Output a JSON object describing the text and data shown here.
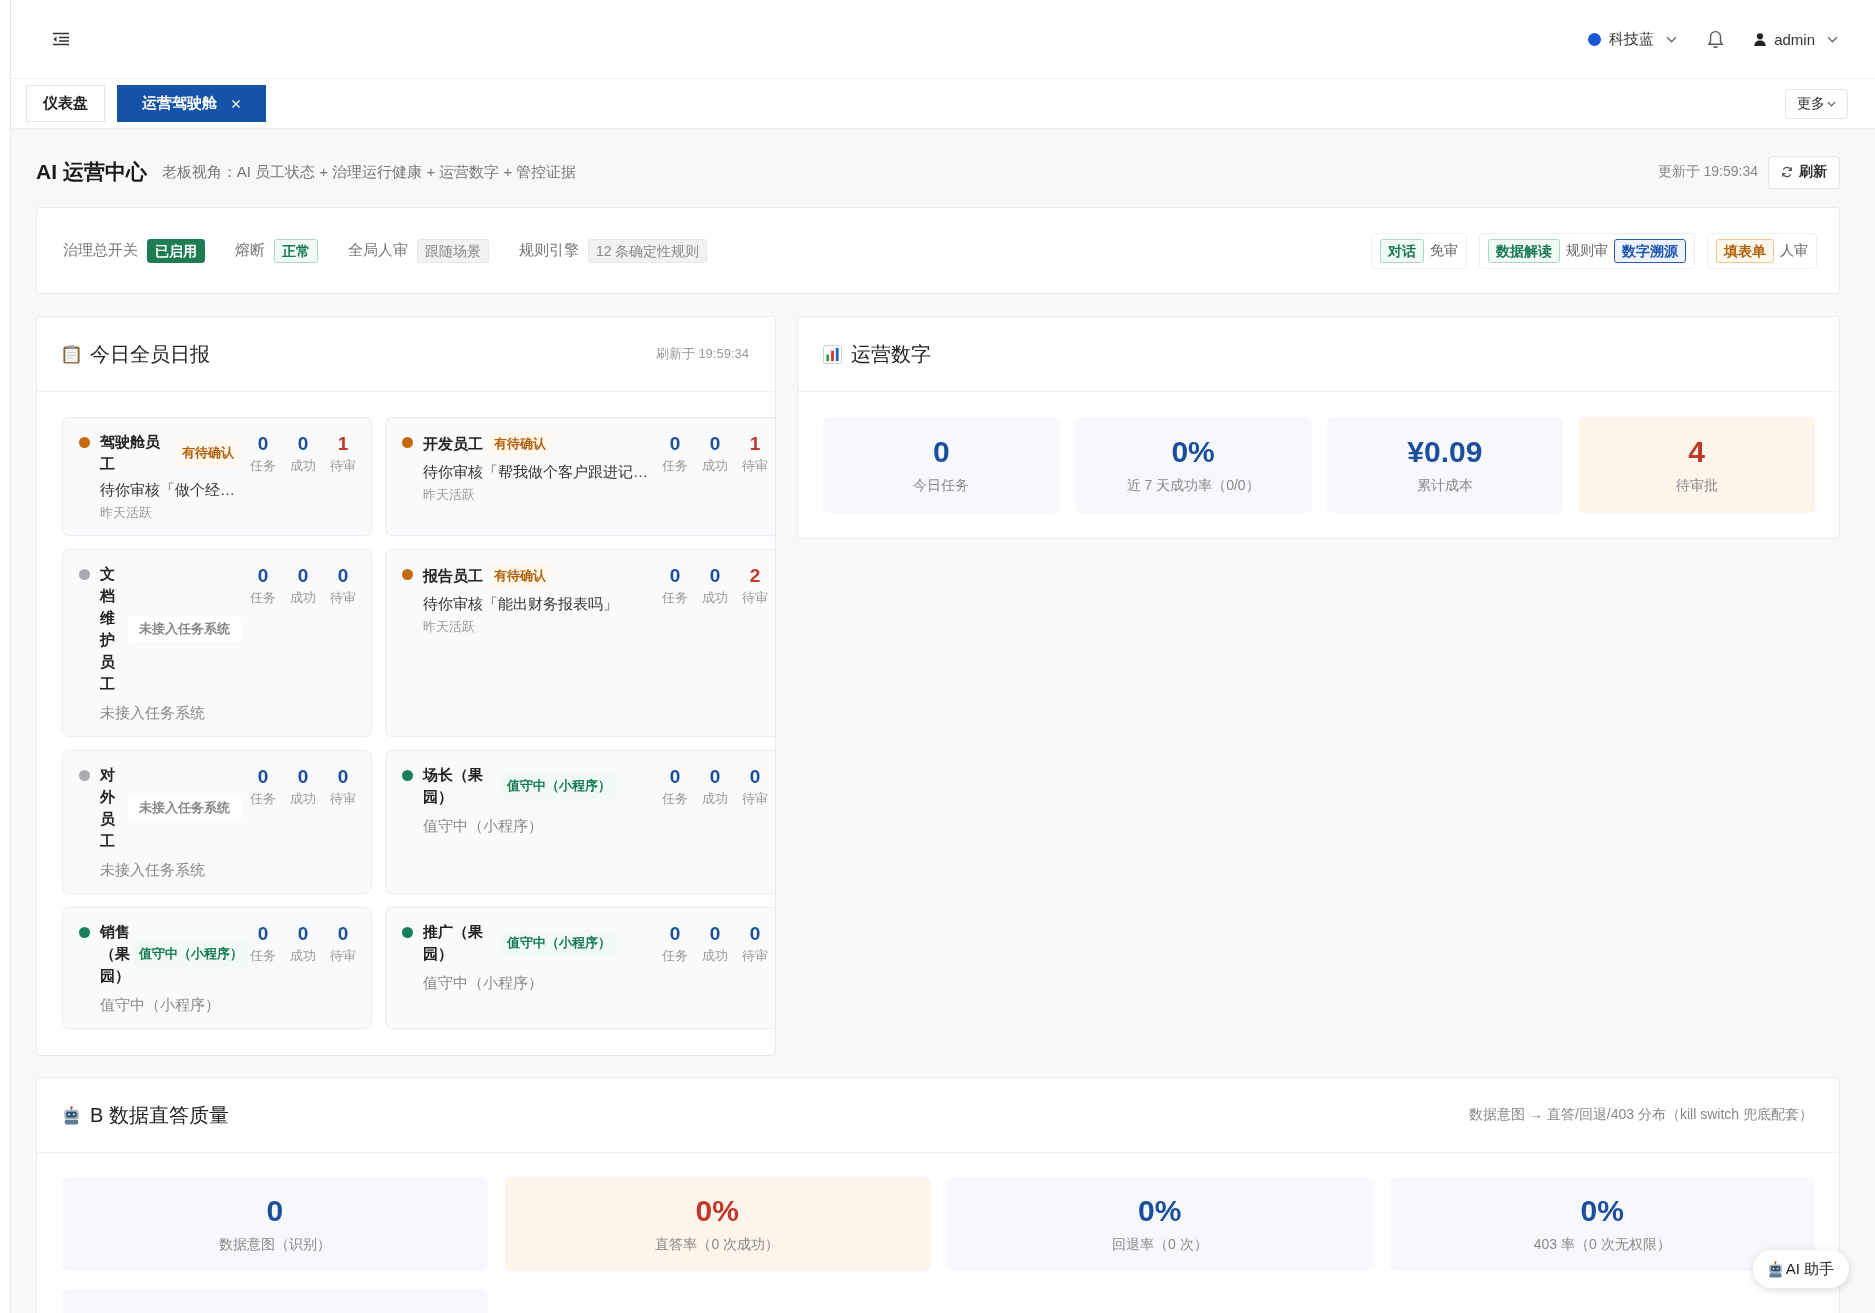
{
  "header": {
    "theme": {
      "label": "科技蓝"
    },
    "user": {
      "name": "admin"
    }
  },
  "tabs": [
    {
      "label": "仪表盘",
      "selected": false,
      "closable": false
    },
    {
      "label": "运营驾驶舱",
      "selected": true,
      "closable": true
    }
  ],
  "more_button": "更多",
  "page": {
    "title": "AI 运营中心",
    "subtitle": "老板视角：AI 员工状态 + 治理运行健康 + 运营数字 + 管控证据",
    "updated": "更新于 19:59:34",
    "refresh_button": "刷新"
  },
  "governance": {
    "items": [
      {
        "label": "治理总开关",
        "tag": {
          "text": "已启用",
          "kind": "solid"
        }
      },
      {
        "label": "熔断",
        "tag": {
          "text": "正常",
          "kind": "success"
        }
      },
      {
        "label": "全局人审",
        "tag": {
          "text": "跟随场景",
          "kind": "neutral"
        }
      },
      {
        "label": "规则引擎",
        "tag": {
          "text": "12 条确定性规则",
          "kind": "neutral"
        }
      }
    ],
    "groups": [
      {
        "parts": [
          {
            "kind": "success",
            "text": "对话"
          },
          {
            "kind": "plain",
            "text": "免审"
          }
        ]
      },
      {
        "parts": [
          {
            "kind": "success",
            "text": "数据解读"
          },
          {
            "kind": "plain",
            "text": "规则审"
          },
          {
            "kind": "info",
            "text": "数字溯源"
          }
        ]
      },
      {
        "parts": [
          {
            "kind": "warning",
            "text": "填表单"
          },
          {
            "kind": "plain",
            "text": "人审"
          }
        ]
      }
    ]
  },
  "daily_report": {
    "title": "今日全员日报",
    "refreshed": "刷新于 19:59:34",
    "employees": [
      {
        "name": "驾驶舱员工",
        "color": "#c4690f",
        "badge": {
          "text": "有待确认",
          "kind": "warning"
        },
        "stats": [
          {
            "value": "0",
            "label": "任务",
            "alert": false
          },
          {
            "value": "0",
            "label": "成功",
            "alert": false
          },
          {
            "value": "1",
            "label": "待审",
            "alert": true
          }
        ],
        "lines": [
          {
            "kind": "task",
            "text": "待你审核「做个经…"
          },
          {
            "kind": "activity",
            "text": "昨天活跃"
          }
        ]
      },
      {
        "name": "开发员工",
        "color": "#c4690f",
        "badge": {
          "text": "有待确认",
          "kind": "warning"
        },
        "stats": [
          {
            "value": "0",
            "label": "任务",
            "alert": false
          },
          {
            "value": "0",
            "label": "成功",
            "alert": false
          },
          {
            "value": "1",
            "label": "待审",
            "alert": true
          }
        ],
        "lines": [
          {
            "kind": "task",
            "text": "待你审核「帮我做个客户跟进记…"
          },
          {
            "kind": "activity",
            "text": "昨天活跃"
          }
        ]
      },
      {
        "name": "文档维护员工",
        "color": "#a9abaf",
        "badge": {
          "text": "未接入任务系统",
          "kind": "muted"
        },
        "stats": [
          {
            "value": "0",
            "label": "任务",
            "alert": false
          },
          {
            "value": "0",
            "label": "成功",
            "alert": false
          },
          {
            "value": "0",
            "label": "待审",
            "alert": false
          }
        ],
        "lines": [
          {
            "kind": "status",
            "text": "未接入任务系统"
          }
        ]
      },
      {
        "name": "报告员工",
        "color": "#c4690f",
        "badge": {
          "text": "有待确认",
          "kind": "warning"
        },
        "stats": [
          {
            "value": "0",
            "label": "任务",
            "alert": false
          },
          {
            "value": "0",
            "label": "成功",
            "alert": false
          },
          {
            "value": "2",
            "label": "待审",
            "alert": true
          }
        ],
        "lines": [
          {
            "kind": "task",
            "text": "待你审核「能出财务报表吗」"
          },
          {
            "kind": "activity",
            "text": "昨天活跃"
          }
        ]
      },
      {
        "name": "对外员工",
        "color": "#a9abaf",
        "badge": {
          "text": "未接入任务系统",
          "kind": "muted"
        },
        "stats": [
          {
            "value": "0",
            "label": "任务",
            "alert": false
          },
          {
            "value": "0",
            "label": "成功",
            "alert": false
          },
          {
            "value": "0",
            "label": "待审",
            "alert": false
          }
        ],
        "lines": [
          {
            "kind": "status",
            "text": "未接入任务系统"
          }
        ]
      },
      {
        "name": "场长（果园）",
        "color": "#17805a",
        "badge": {
          "text": "值守中（小程序）",
          "kind": "success"
        },
        "stats": [
          {
            "value": "0",
            "label": "任务",
            "alert": false
          },
          {
            "value": "0",
            "label": "成功",
            "alert": false
          },
          {
            "value": "0",
            "label": "待审",
            "alert": false
          }
        ],
        "lines": [
          {
            "kind": "status",
            "text": "值守中（小程序）"
          }
        ]
      },
      {
        "name": "销售（果园）",
        "color": "#17805a",
        "badge": {
          "text": "值守中（小程序）",
          "kind": "success"
        },
        "stats": [
          {
            "value": "0",
            "label": "任务",
            "alert": false
          },
          {
            "value": "0",
            "label": "成功",
            "alert": false
          },
          {
            "value": "0",
            "label": "待审",
            "alert": false
          }
        ],
        "lines": [
          {
            "kind": "status",
            "text": "值守中（小程序）"
          }
        ]
      },
      {
        "name": "推广（果园）",
        "color": "#17805a",
        "badge": {
          "text": "值守中（小程序）",
          "kind": "success"
        },
        "stats": [
          {
            "value": "0",
            "label": "任务",
            "alert": false
          },
          {
            "value": "0",
            "label": "成功",
            "alert": false
          },
          {
            "value": "0",
            "label": "待审",
            "alert": false
          }
        ],
        "lines": [
          {
            "kind": "status",
            "text": "值守中（小程序）"
          }
        ]
      }
    ]
  },
  "ops_metrics": {
    "title": "运营数字",
    "metrics": [
      {
        "value": "0",
        "label": "今日任务",
        "alert": false
      },
      {
        "value": "0%",
        "label": "近 7 天成功率（0/0）",
        "alert": false
      },
      {
        "value": "¥0.09",
        "label": "累计成本",
        "alert": false
      },
      {
        "value": "4",
        "label": "待审批",
        "alert": true
      }
    ]
  },
  "data_quality": {
    "title": "B 数据直答质量",
    "note": "数据意图 → 直答/回退/403 分布（kill switch 兜底配套）",
    "metrics": [
      {
        "value": "0",
        "label": "数据意图（识别）",
        "alert": false
      },
      {
        "value": "0%",
        "label": "直答率（0 次成功）",
        "alert": true
      },
      {
        "value": "0%",
        "label": "回退率（0 次）",
        "alert": false
      },
      {
        "value": "0%",
        "label": "403 率（0 次无权限）",
        "alert": false
      },
      {
        "alert": false
      }
    ]
  },
  "assistant_button": "AI 助手"
}
